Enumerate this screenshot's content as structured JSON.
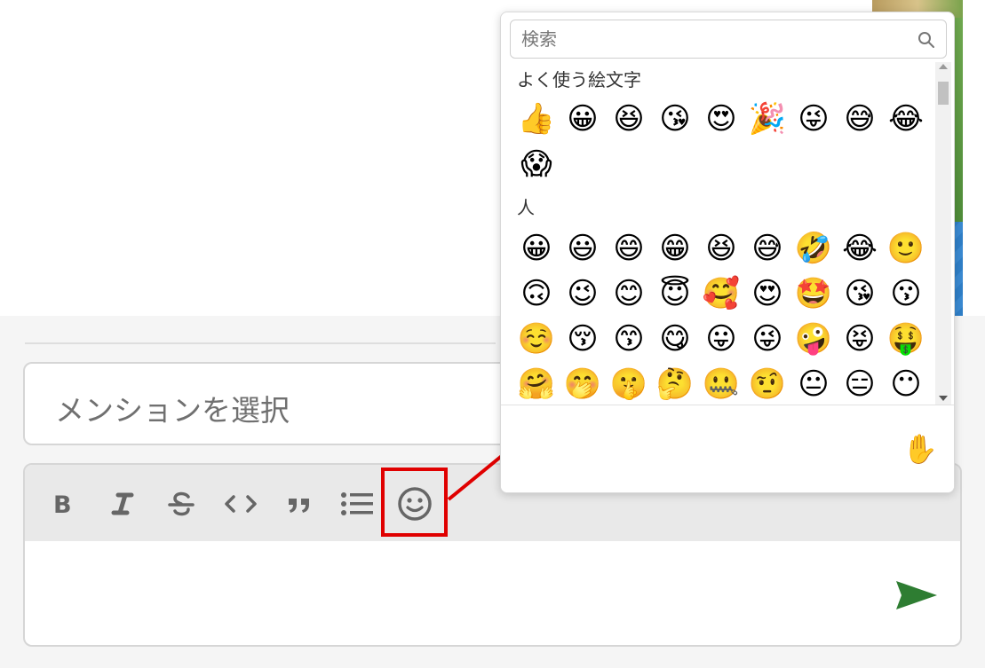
{
  "mention": {
    "placeholder": "メンションを選択"
  },
  "toolbar": {
    "buttons": [
      {
        "name": "bold",
        "label": "B"
      },
      {
        "name": "italic",
        "label": "I"
      },
      {
        "name": "strikethrough",
        "label": "S"
      },
      {
        "name": "code",
        "label": "<>"
      },
      {
        "name": "quote",
        "label": "❞"
      },
      {
        "name": "list",
        "label": "☰"
      },
      {
        "name": "emoji",
        "label": "☺"
      }
    ]
  },
  "emoji_picker": {
    "search_placeholder": "検索",
    "sections": [
      {
        "title": "よく使う絵文字",
        "emojis": [
          "👍",
          "😀",
          "😆",
          "😘",
          "😍",
          "🎉",
          "😜",
          "😅",
          "😂",
          "😱"
        ]
      },
      {
        "title": "人",
        "emojis": [
          "😀",
          "😃",
          "😄",
          "😁",
          "😆",
          "😅",
          "🤣",
          "😂",
          "🙂",
          "🙃",
          "😉",
          "😊",
          "😇",
          "🥰",
          "😍",
          "🤩",
          "😘",
          "😗",
          "☺️",
          "😚",
          "😙",
          "😋",
          "😛",
          "😜",
          "🤪",
          "😝",
          "🤑",
          "🤗",
          "🤭",
          "🤫",
          "🤔",
          "🤐",
          "🤨",
          "😐",
          "😑",
          "😶"
        ]
      }
    ],
    "skin_tone_emoji": "✋"
  },
  "colors": {
    "annotation_red": "#e00000",
    "send_green": "#2e7d32",
    "toolbar_bg": "#e9e9e9"
  },
  "icons": {
    "search": "search-icon",
    "send": "send-icon",
    "emoji": "smile-icon"
  }
}
